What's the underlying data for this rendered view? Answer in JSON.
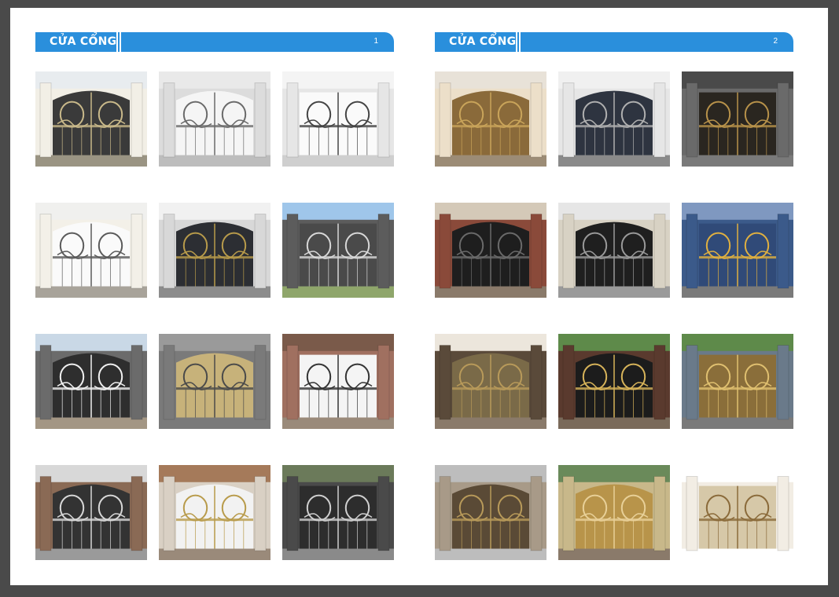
{
  "pages": [
    {
      "title": "CỬA CỔNG",
      "number": "1"
    },
    {
      "title": "CỬA CỔNG",
      "number": "2"
    }
  ],
  "photos": [
    [
      "white-villa-gate",
      "floral-panel-gate",
      "phat-tai-phat-loc-gate",
      "white-villa-side-gate",
      "black-gold-ornate-gate",
      "swirl-sliding-gate",
      "black-swirl-fence-gate",
      "gold-floral-panel-gate",
      "white-floral-gate",
      "tile-roof-black-gate",
      "white-ellipse-gate",
      "dragonfly-sliding-gate"
    ],
    [
      "villa-bronze-fence-gate",
      "black-arch-pillar-gate",
      "bronze-arch-gate",
      "black-scroll-gate",
      "black-swirl-arch-gate",
      "blue-leaf-motif-gate",
      "bronze-fence-villa-gate",
      "black-gold-sun-gate",
      "gold-peacock-gate",
      "bronze-long-fence-gate",
      "gold-arch-ornate-gate",
      "white-gold-palace-gate"
    ]
  ]
}
